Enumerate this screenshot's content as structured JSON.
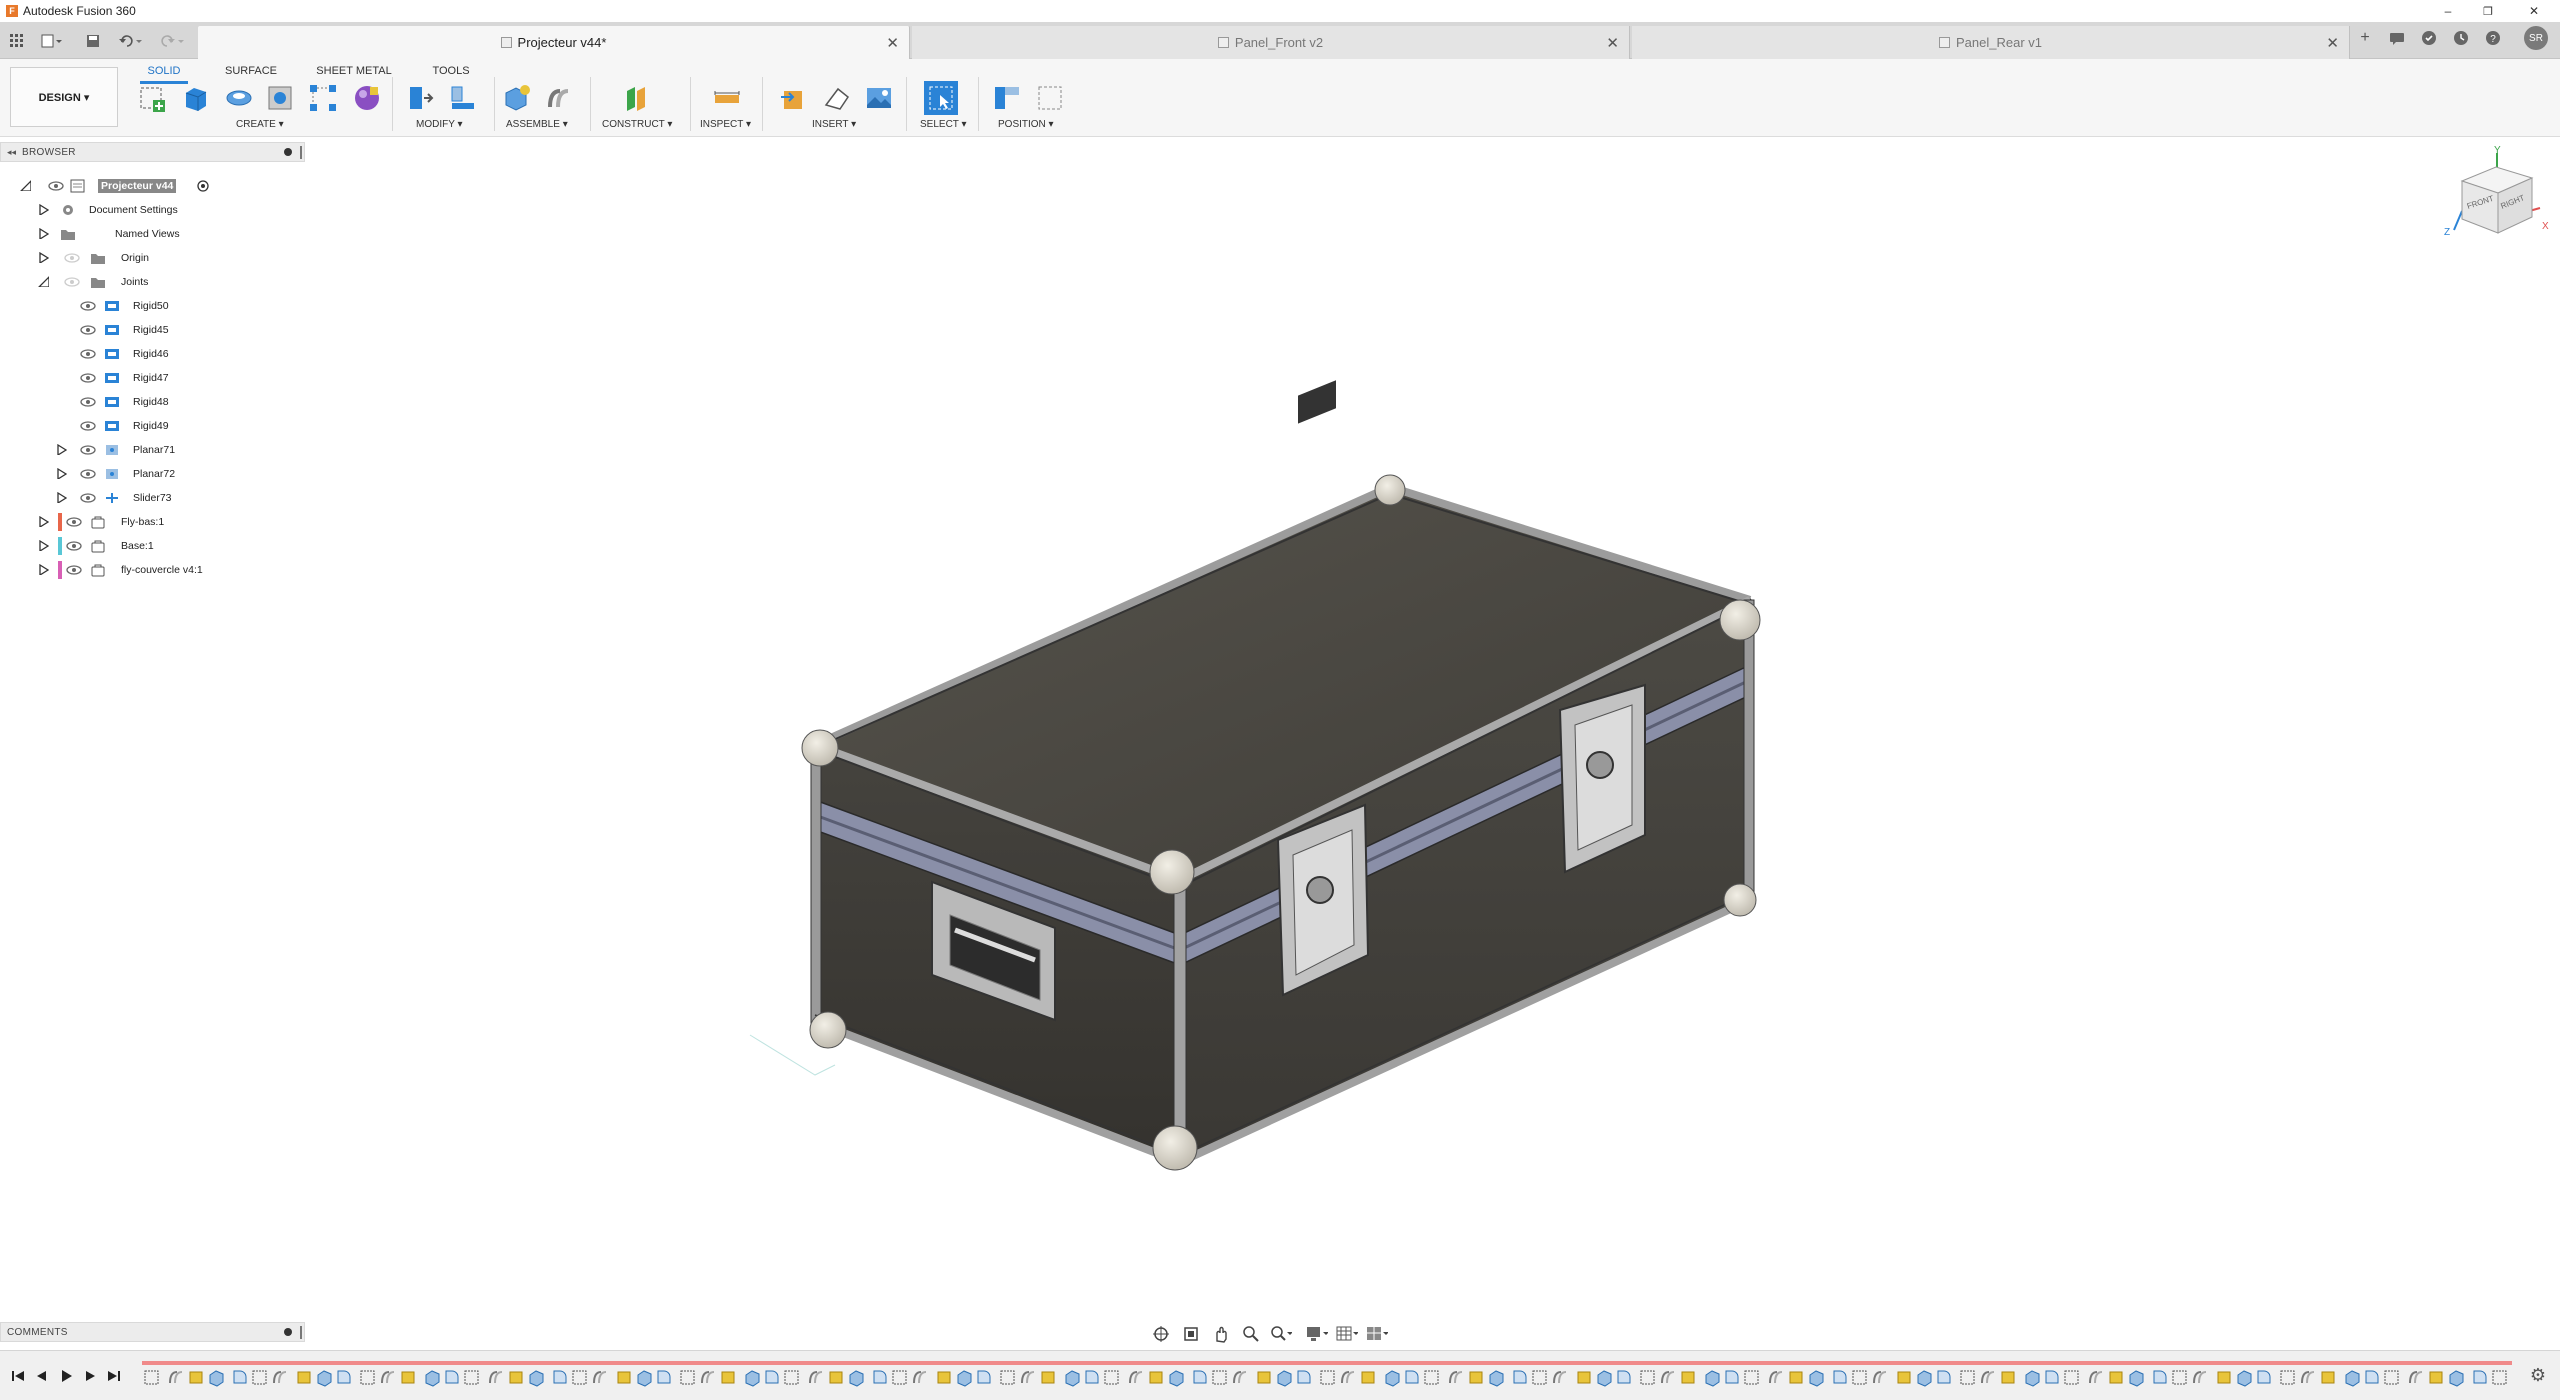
{
  "app": {
    "title": "Autodesk Fusion 360",
    "logo_letter": "F"
  },
  "window": {
    "minimize": "–",
    "restore": "❐",
    "close": "✕"
  },
  "tabs": [
    {
      "label": "Projecteur v44*",
      "active": true
    },
    {
      "label": "Panel_Front v2",
      "active": false
    },
    {
      "label": "Panel_Rear v1",
      "active": false
    }
  ],
  "header_right": {
    "add": "+",
    "user_initials": "SR"
  },
  "toolbar": {
    "design_label": "DESIGN ▾",
    "workspace_tabs": [
      "SOLID",
      "SURFACE",
      "SHEET METAL",
      "TOOLS"
    ],
    "groups": [
      "CREATE ▾",
      "MODIFY ▾",
      "ASSEMBLE ▾",
      "CONSTRUCT ▾",
      "INSPECT ▾",
      "INSERT ▾",
      "SELECT ▾",
      "POSITION ▾"
    ]
  },
  "browser": {
    "title": "BROWSER",
    "rows": [
      {
        "label": "Projecteur v44",
        "indent": 0,
        "toggle": "open",
        "eye": true,
        "icon": "doc-icon",
        "root": true
      },
      {
        "label": "Document Settings",
        "indent": 1,
        "toggle": "closed",
        "eye": false,
        "icon": "gear-icon"
      },
      {
        "label": "Named Views",
        "indent": 1,
        "toggle": "closed",
        "eye": false,
        "icon": "folder-icon"
      },
      {
        "label": "Origin",
        "indent": 1,
        "toggle": "closed",
        "eye": "dim",
        "icon": "folder-icon"
      },
      {
        "label": "Joints",
        "indent": 1,
        "toggle": "open",
        "eye": "dim",
        "icon": "folder-icon"
      },
      {
        "label": "Rigid50",
        "indent": 2,
        "toggle": "none",
        "eye": true,
        "icon": "joint-icon"
      },
      {
        "label": "Rigid45",
        "indent": 2,
        "toggle": "none",
        "eye": true,
        "icon": "joint-icon"
      },
      {
        "label": "Rigid46",
        "indent": 2,
        "toggle": "none",
        "eye": true,
        "icon": "joint-icon"
      },
      {
        "label": "Rigid47",
        "indent": 2,
        "toggle": "none",
        "eye": true,
        "icon": "joint-icon"
      },
      {
        "label": "Rigid48",
        "indent": 2,
        "toggle": "none",
        "eye": true,
        "icon": "joint-icon"
      },
      {
        "label": "Rigid49",
        "indent": 2,
        "toggle": "none",
        "eye": true,
        "icon": "joint-icon"
      },
      {
        "label": "Planar71",
        "indent": 2,
        "toggle": "closed",
        "eye": true,
        "icon": "planar-icon"
      },
      {
        "label": "Planar72",
        "indent": 2,
        "toggle": "closed",
        "eye": true,
        "icon": "planar-icon"
      },
      {
        "label": "Slider73",
        "indent": 2,
        "toggle": "closed",
        "eye": true,
        "icon": "slider-icon"
      },
      {
        "label": "Fly-bas:1",
        "indent": 1,
        "toggle": "closed",
        "eye": true,
        "icon": "component-icon",
        "color": "#e8664a"
      },
      {
        "label": "Base:1",
        "indent": 1,
        "toggle": "closed",
        "eye": true,
        "icon": "component-icon",
        "color": "#59c7d6"
      },
      {
        "label": "fly-couvercle v4:1",
        "indent": 1,
        "toggle": "closed",
        "eye": true,
        "icon": "component-icon",
        "color": "#d85fb5"
      }
    ]
  },
  "comments": {
    "title": "COMMENTS"
  },
  "viewcube": {
    "front": "FRONT",
    "right": "RIGHT",
    "x": "X",
    "y": "Y",
    "z": "Z"
  },
  "colors": {
    "accent": "#2a83d6",
    "timeline_bar": "#f08a8a"
  }
}
